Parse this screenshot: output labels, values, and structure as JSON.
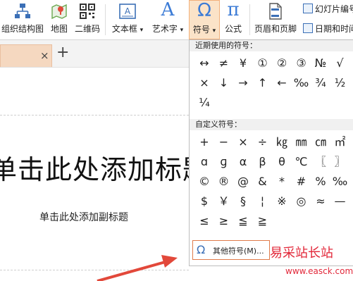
{
  "ribbon": {
    "org_chart": "组织结构图",
    "map": "地图",
    "qrcode": "二维码",
    "textbox": "文本框",
    "wordart": "艺术字",
    "symbol": "符号",
    "formula": "公式",
    "header_footer": "页眉和页脚",
    "slide_number": "幻灯片编号",
    "date_time": "日期和时间",
    "dropdown_mark": "▾",
    "symbol_icon_glyph": "Ω",
    "formula_icon_glyph": "π",
    "wordart_icon_glyph": "A",
    "accent_color": "#f2b07b"
  },
  "tabbar": {
    "close_glyph": "×",
    "add_glyph": "+"
  },
  "slide": {
    "title": "单击此处添加标题",
    "subtitle": "单击此处添加副标题"
  },
  "dropdown": {
    "recent_header": "近期使用的符号：",
    "recent_symbols": [
      [
        "↔",
        "≠",
        "¥",
        "①",
        "②",
        "③",
        "№",
        "√"
      ],
      [
        "×",
        "↓",
        "→",
        "↑",
        "←",
        "‰",
        "¾",
        "½"
      ],
      [
        "¼"
      ]
    ],
    "custom_header": "自定义符号：",
    "custom_symbols": [
      [
        "+",
        "−",
        "×",
        "÷",
        "㎏",
        "㎜",
        "㎝",
        "㎡"
      ],
      [
        "ɑ",
        "ɡ",
        "α",
        "β",
        "θ",
        "℃",
        "〖",
        "〗"
      ],
      [
        "©",
        "®",
        "@",
        "&",
        "*",
        "#",
        "%",
        "‰"
      ],
      [
        "$",
        "￥",
        "§",
        "¦",
        "※",
        "◎",
        "≈",
        "—"
      ],
      [
        "≤",
        "≥",
        "≦",
        "≧"
      ]
    ],
    "other_symbols": "其他符号(M)..."
  },
  "watermark": {
    "text": "易采站长站",
    "url": "www.easck.com",
    "color": "#e2283a"
  }
}
